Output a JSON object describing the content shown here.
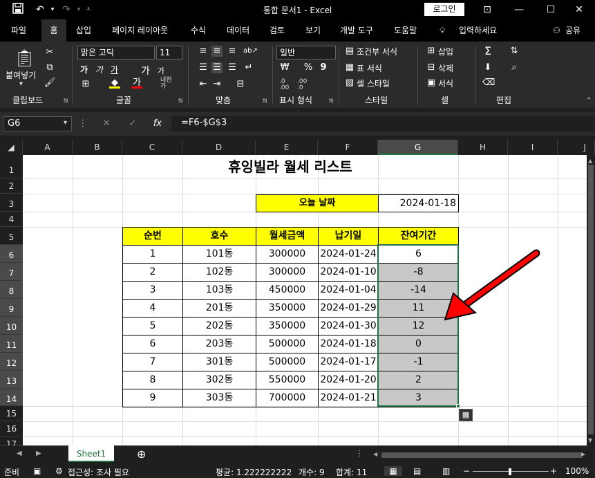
{
  "titlebar": {
    "title": "통합 문서1  -  Excel",
    "login": "로그인"
  },
  "menu": [
    "파일",
    "홈",
    "삽입",
    "페이지 레이아웃",
    "수식",
    "데이터",
    "검토",
    "보기",
    "개발 도구",
    "도움말",
    "입력하세요",
    "공유"
  ],
  "ribbon": {
    "paste_label": "붙여넣기",
    "font_name": "맑은 고딕",
    "font_size": "11",
    "number_format": "일반",
    "conditional_format": "조건부 서식",
    "table_format": "표 서식",
    "cell_style": "셀 스타일",
    "insert": "삽입",
    "delete": "삭제",
    "format": "서식",
    "groups": [
      "클립보드",
      "글꼴",
      "맞춤",
      "표시 형식",
      "스타일",
      "셀",
      "편집"
    ]
  },
  "formulabar": {
    "name_box": "G6",
    "formula": "=F6-$G$3"
  },
  "columns": [
    "A",
    "B",
    "C",
    "D",
    "E",
    "F",
    "G",
    "H",
    "I",
    "J"
  ],
  "rows": [
    "1",
    "2",
    "3",
    "4",
    "5",
    "6",
    "7",
    "8",
    "9",
    "10",
    "11",
    "12",
    "13",
    "14",
    "15",
    "16",
    "17"
  ],
  "sheet": {
    "title": "휴잉빌라 월세 리스트",
    "today_label": "오늘 날짜",
    "today_value": "2024-01-18",
    "headers": [
      "순번",
      "호수",
      "월세금액",
      "납기일",
      "잔여기간"
    ],
    "table": [
      [
        "1",
        "101동",
        "300000",
        "2024-01-24",
        "6"
      ],
      [
        "2",
        "102동",
        "300000",
        "2024-01-10",
        "-8"
      ],
      [
        "3",
        "103동",
        "450000",
        "2024-01-04",
        "-14"
      ],
      [
        "4",
        "201동",
        "350000",
        "2024-01-29",
        "11"
      ],
      [
        "5",
        "202동",
        "350000",
        "2024-01-30",
        "12"
      ],
      [
        "6",
        "203동",
        "500000",
        "2024-01-18",
        "0"
      ],
      [
        "7",
        "301동",
        "500000",
        "2024-01-17",
        "-1"
      ],
      [
        "8",
        "302동",
        "550000",
        "2024-01-20",
        "2"
      ],
      [
        "9",
        "303동",
        "700000",
        "2024-01-21",
        "3"
      ]
    ]
  },
  "sheet_tab": "Sheet1",
  "status": {
    "ready": "준비",
    "accessibility": "접근성: 조사 필요",
    "average": "평균: 1.222222222",
    "count": "개수: 9",
    "sum": "합계: 11",
    "zoom": "100%"
  },
  "colors": {
    "accent": "#217346",
    "header_yellow": "#ffff00",
    "selection_gray": "#c8c8c8",
    "arrow": "#ff0000"
  }
}
